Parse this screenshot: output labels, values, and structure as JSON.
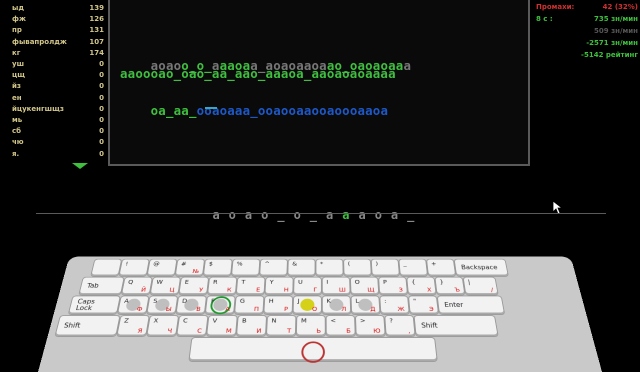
{
  "left_stats": [
    {
      "label": "ыд",
      "value": "139"
    },
    {
      "label": "фж",
      "value": "126"
    },
    {
      "label": "пр",
      "value": "131"
    },
    {
      "label": "фывапролдж",
      "value": "107"
    },
    {
      "label": "кг",
      "value": "174"
    },
    {
      "label": "уш",
      "value": "0"
    },
    {
      "label": "цщ",
      "value": "0"
    },
    {
      "label": "йз",
      "value": "0"
    },
    {
      "label": "ен",
      "value": "0"
    },
    {
      "label": "йцукенгшщз",
      "value": "0"
    },
    {
      "label": "мь",
      "value": "0"
    },
    {
      "label": "сб",
      "value": "0"
    },
    {
      "label": "чю",
      "value": "0"
    },
    {
      "label": "я.",
      "value": "0"
    }
  ],
  "text_lines": [
    {
      "done": "",
      "todo": "аоао",
      "done2": "о_о_",
      "todo2": "а",
      "done3": "ааоа",
      "todo3": "а_аоаоааоа",
      "done4": "ао_оаоаоаа",
      "todo4": "а"
    },
    {
      "all": "ааоооао_оао_аа_аао_аааоа_ааоаоаоаааа"
    },
    {
      "typed": "оа_аа_",
      "current": "о",
      "rest": "оаоааа_ооаооааооаоооааоа"
    }
  ],
  "right_stats": [
    {
      "label": "Промахи:",
      "value": "42 (32%)",
      "label_color": "#d23030",
      "value_color": "#d23030"
    },
    {
      "label": "8 с :",
      "value": "735 зн/мин",
      "label_color": "#3fbf3f",
      "value_color": "#3fbf3f"
    },
    {
      "label": "",
      "value": "509 зн/мин",
      "label_color": "#888888",
      "value_color": "#555555"
    },
    {
      "label": "",
      "value": "-2571 зн/мин",
      "label_color": "#3fbf3f",
      "value_color": "#3fbf3f"
    },
    {
      "label": "",
      "value": "-5142 рейтинг",
      "label_color": "#3fbf3f",
      "value_color": "#3fbf3f"
    }
  ],
  "flow_line": {
    "upcoming": "аоао_о_а",
    "cursor_char": "а",
    "rest": "аоа_"
  },
  "keyboard": {
    "row1": [
      {
        "en": "",
        "ru": "",
        "lbl": ""
      },
      {
        "en": "!",
        "ru": ""
      },
      {
        "en": "@",
        "ru": ""
      },
      {
        "en": "#",
        "ru": "№"
      },
      {
        "en": "$",
        "ru": ""
      },
      {
        "en": "%",
        "ru": ""
      },
      {
        "en": "^",
        "ru": ""
      },
      {
        "en": "&",
        "ru": ""
      },
      {
        "en": "*",
        "ru": ""
      },
      {
        "en": "(",
        "ru": ""
      },
      {
        "en": ")",
        "ru": ""
      },
      {
        "en": "_",
        "ru": ""
      },
      {
        "en": "+",
        "ru": ""
      },
      {
        "lbl": "Backspace"
      }
    ],
    "row2": [
      {
        "lbl": "Tab"
      },
      {
        "en": "Q",
        "ru": "Й"
      },
      {
        "en": "W",
        "ru": "Ц"
      },
      {
        "en": "E",
        "ru": "У"
      },
      {
        "en": "R",
        "ru": "К"
      },
      {
        "en": "T",
        "ru": "Е"
      },
      {
        "en": "Y",
        "ru": "Н"
      },
      {
        "en": "U",
        "ru": "Г"
      },
      {
        "en": "I",
        "ru": "Ш"
      },
      {
        "en": "O",
        "ru": "Щ"
      },
      {
        "en": "P",
        "ru": "З"
      },
      {
        "en": "{",
        "ru": "Х"
      },
      {
        "en": "}",
        "ru": "Ъ"
      },
      {
        "en": "|",
        "ru": "/"
      }
    ],
    "row3": [
      {
        "lbl": "Caps\nLock"
      },
      {
        "en": "A",
        "ru": "Ф"
      },
      {
        "en": "S",
        "ru": "Ы"
      },
      {
        "en": "D",
        "ru": "В"
      },
      {
        "en": "F",
        "ru": "А"
      },
      {
        "en": "G",
        "ru": "П"
      },
      {
        "en": "H",
        "ru": "Р"
      },
      {
        "en": "J",
        "ru": "О"
      },
      {
        "en": "K",
        "ru": "Л"
      },
      {
        "en": "L",
        "ru": "Д"
      },
      {
        "en": ":",
        "ru": "Ж"
      },
      {
        "en": "\"",
        "ru": "Э"
      },
      {
        "lbl": "Enter"
      }
    ],
    "row4": [
      {
        "lbl": "Shift"
      },
      {
        "en": "Z",
        "ru": "Я"
      },
      {
        "en": "X",
        "ru": "Ч"
      },
      {
        "en": "C",
        "ru": "С"
      },
      {
        "en": "V",
        "ru": "М"
      },
      {
        "en": "B",
        "ru": "И"
      },
      {
        "en": "N",
        "ru": "Т"
      },
      {
        "en": "M",
        "ru": "Ь"
      },
      {
        "en": "<",
        "ru": "Б"
      },
      {
        "en": ">",
        "ru": "Ю"
      },
      {
        "en": "?",
        "ru": ","
      },
      {
        "lbl": "Shift"
      }
    ]
  }
}
